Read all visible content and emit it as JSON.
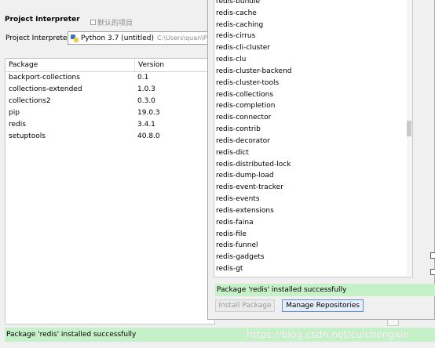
{
  "settings": {
    "title": "Project Interpreter",
    "subtitle": "默认的项目",
    "interpreter_label": "Project Interpreter:",
    "interpreter_name": "Python 3.7 (untitled)",
    "interpreter_path": "C:\\Users\\quan\\Pycharm"
  },
  "package_table": {
    "headers": [
      "Package",
      "Version"
    ],
    "rows": [
      {
        "package": "backport-collections",
        "version": "0.1"
      },
      {
        "package": "collections-extended",
        "version": "1.0.3"
      },
      {
        "package": "collections2",
        "version": "0.3.0"
      },
      {
        "package": "pip",
        "version": "19.0.3"
      },
      {
        "package": "redis",
        "version": "3.4.1"
      },
      {
        "package": "setuptools",
        "version": "40.8.0"
      }
    ]
  },
  "left_status": "Package 'redis' installed successfully",
  "available_packages": {
    "items": [
      "redis-bundle",
      "redis-cache",
      "redis-caching",
      "redis-cirrus",
      "redis-cli-cluster",
      "redis-clu",
      "redis-cluster-backend",
      "redis-cluster-tools",
      "redis-collections",
      "redis-completion",
      "redis-connector",
      "redis-contrib",
      "redis-decorator",
      "redis-dict",
      "redis-distributed-lock",
      "redis-dump-load",
      "redis-event-tracker",
      "redis-events",
      "redis-extensions",
      "redis-faina",
      "redis-file",
      "redis-funnel",
      "redis-gadgets",
      "redis-gt"
    ],
    "status": "Package 'redis' installed successfully",
    "install_button": "Install Package",
    "manage_button": "Manage Repositories"
  },
  "watermark": "https://blog.csdn.net/cuichongxin"
}
